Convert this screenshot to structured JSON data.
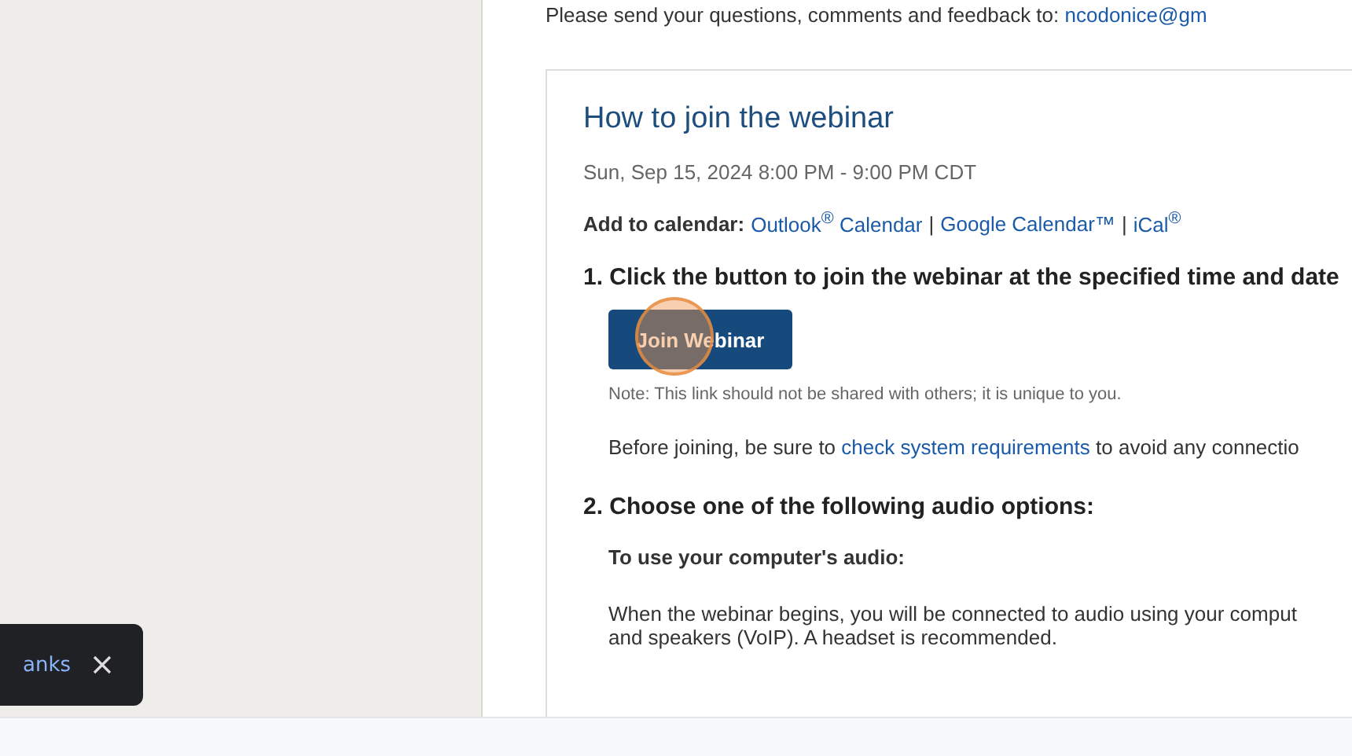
{
  "feedback": {
    "text": "Please send your questions, comments and feedback to:",
    "email": "ncodonice@gm"
  },
  "card": {
    "title": "How to join the webinar",
    "datetime": "Sun, Sep 15, 2024 8:00 PM - 9:00 PM CDT",
    "calendar_label": "Add to calendar:",
    "calendar_links": [
      {
        "label": "Outlook$^{®}$ Calendar"
      },
      {
        "label": "Google Calendar™"
      },
      {
        "label": "iCal$^{®}$"
      }
    ],
    "separator": "|",
    "step1": "1. Click the button to join the webinar at the specified time and date",
    "join_button": "Join Webinar",
    "note": "Note: This link should not be shared with others; it is unique to you.",
    "before_text": "Before joining, be sure to",
    "requirements_link": "check system requirements",
    "after_text": "to avoid any connectio",
    "step2": "2. Choose one of the following audio options:",
    "audio_heading": "To use your computer's audio:",
    "audio_text": "When the webinar begins, you will be connected to audio using your comput",
    "audio_text_2": "and speakers (VoIP). A headset is recommended."
  },
  "toast": {
    "text": "anks"
  }
}
